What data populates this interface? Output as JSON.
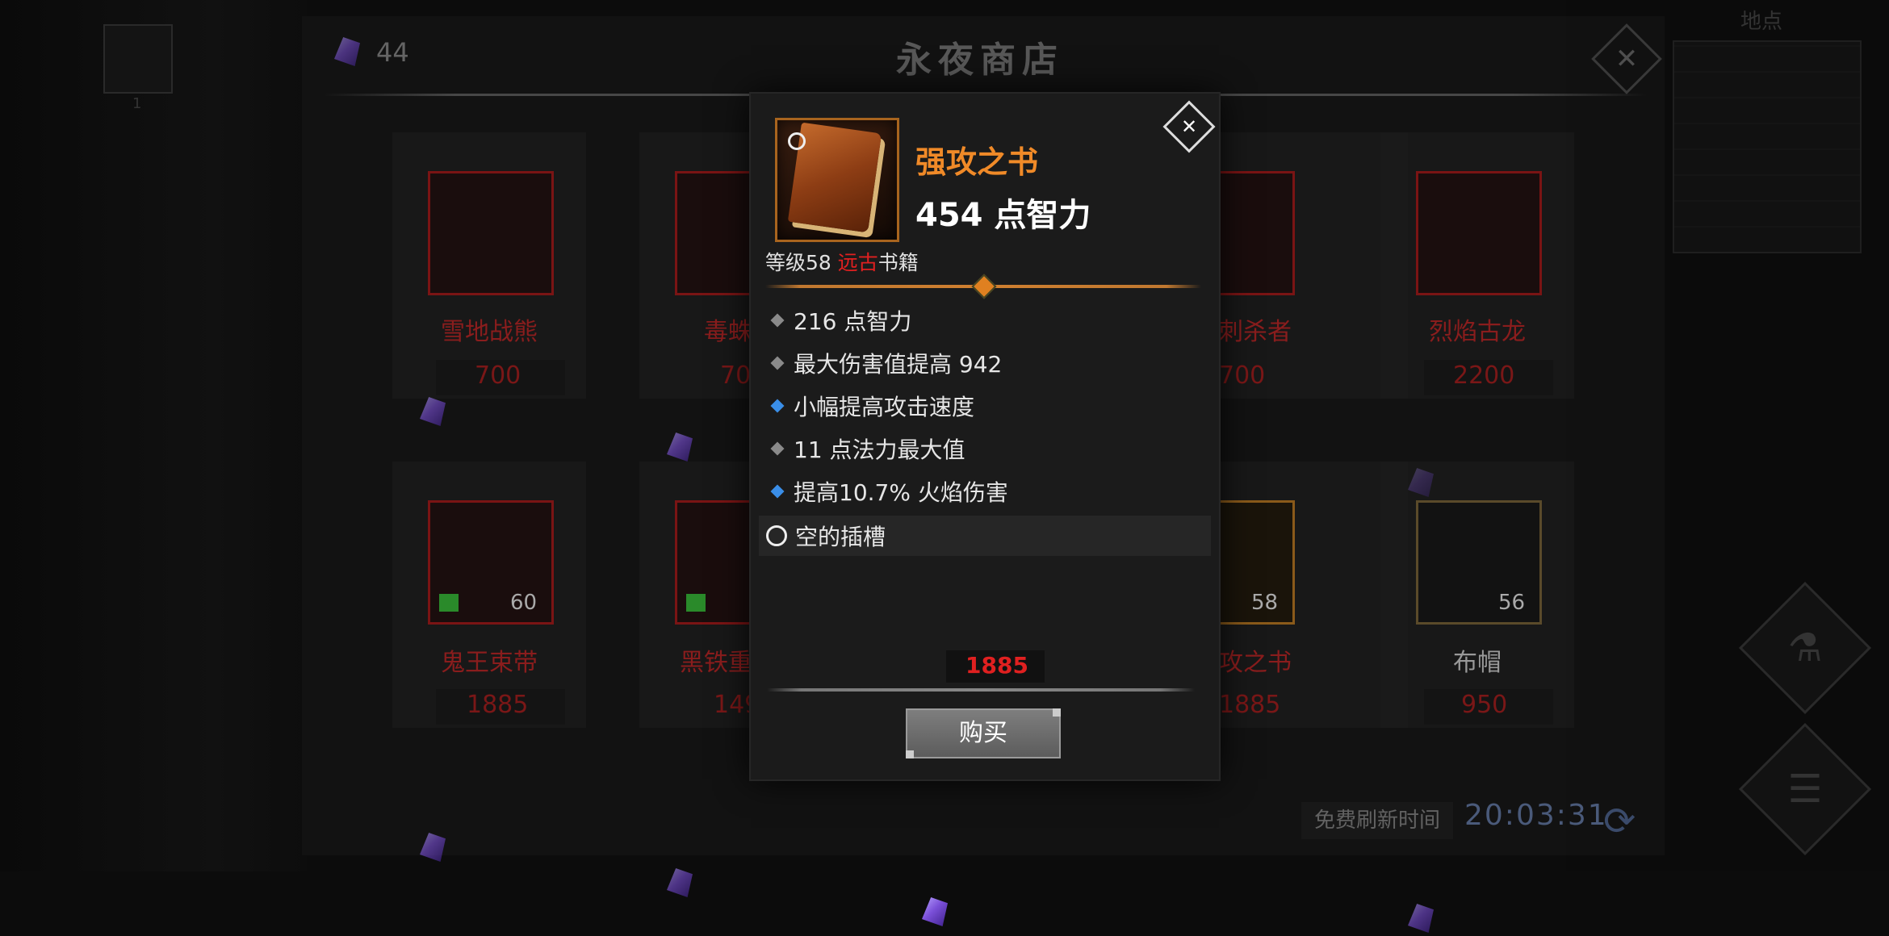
{
  "background": {
    "left_slot_number": "1",
    "right_label": "地点"
  },
  "shop": {
    "gem_count": "44",
    "title": "永夜商店",
    "items_row1": [
      {
        "name": "雪地战熊",
        "price": "700"
      },
      {
        "name": "毒蛛",
        "price": "700"
      },
      {
        "name": "刺杀者",
        "price": "700"
      },
      {
        "name": "烈焰古龙",
        "price": "2200"
      }
    ],
    "items_row2": [
      {
        "name": "鬼王束带",
        "price": "1885",
        "level": "60"
      },
      {
        "name": "黑铁重",
        "price": "1499"
      },
      {
        "name": "攻之书",
        "price": "1885",
        "level": "58"
      },
      {
        "name": "布帽",
        "price": "950",
        "level": "56"
      }
    ],
    "refresh_label": "免费刷新时间",
    "refresh_time": "20:03:31"
  },
  "popup": {
    "item_name": "强攻之书",
    "main_stat": "454 点智力",
    "level_prefix": "等级58 ",
    "rarity": "远古",
    "item_type": "书籍",
    "affixes": [
      {
        "text": "216 点智力",
        "bullet": "grey"
      },
      {
        "text": "最大伤害值提高 942",
        "bullet": "grey"
      },
      {
        "text": "小幅提高攻击速度",
        "bullet": "blue"
      },
      {
        "text": "11 点法力最大值",
        "bullet": "grey"
      },
      {
        "text": "提高10.7% 火焰伤害",
        "bullet": "blue"
      }
    ],
    "empty_socket": "空的插槽",
    "price": "1885",
    "buy_label": "购买"
  },
  "colors": {
    "item_name": "#f08a28",
    "rarity_red": "#e02020",
    "bullet_blue": "#3a8ee8"
  }
}
